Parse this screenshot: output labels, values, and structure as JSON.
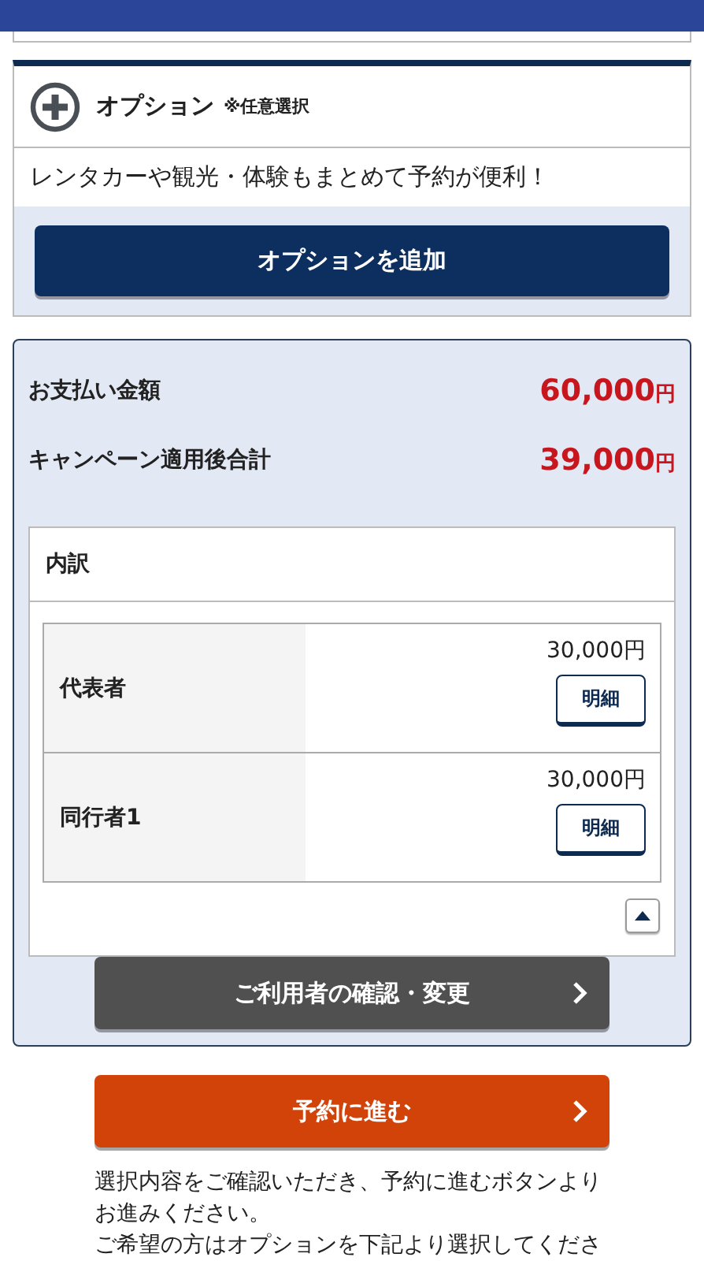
{
  "option": {
    "title": "オプション",
    "note": "※任意選択",
    "description": "レンタカーや観光・体験もまとめて予約が便利！",
    "button": "オプションを追加"
  },
  "payment": {
    "rows": [
      {
        "label": "お支払い金額",
        "amount": "60,000",
        "unit": "円"
      },
      {
        "label": "キャンペーン適用後合計",
        "amount": "39,000",
        "unit": "円"
      }
    ],
    "breakdown": {
      "title": "内訳",
      "expanded": true,
      "rows": [
        {
          "label": "代表者",
          "amount": "30,000円",
          "button": "明細"
        },
        {
          "label": "同行者1",
          "amount": "30,000円",
          "button": "明細"
        }
      ]
    },
    "button": "ご利用者の確認・変更"
  },
  "proceed_button": "予約に進む",
  "notes": [
    "選択内容をご確認いただき、予約に進むボタンより",
    "お進みください。",
    "ご希望の方はオプションを下記より選択してくださ"
  ]
}
